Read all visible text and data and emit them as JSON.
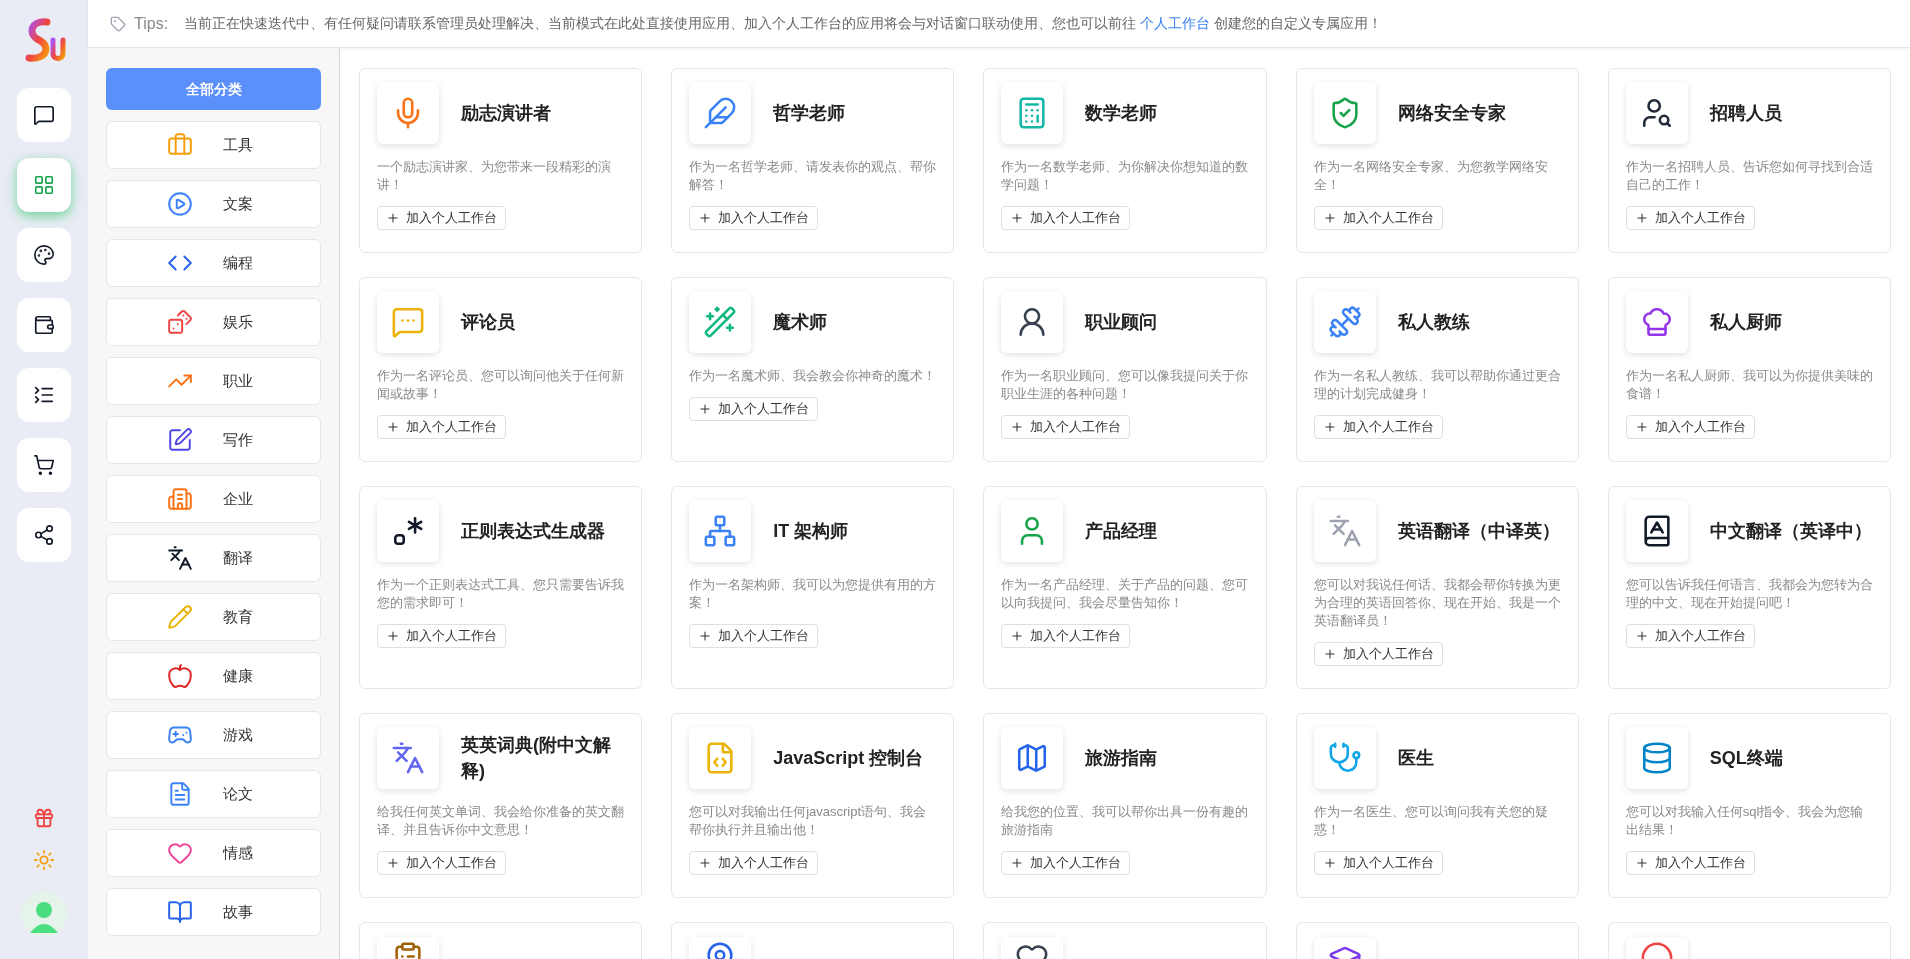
{
  "rail": {
    "items": [
      {
        "selected": false
      },
      {
        "selected": true
      },
      {
        "selected": false
      },
      {
        "selected": false
      },
      {
        "selected": false
      },
      {
        "selected": false
      },
      {
        "selected": false
      }
    ]
  },
  "tips": {
    "label": "Tips:",
    "text_before": "当前正在快速迭代中、有任何疑问请联系管理员处理解决、当前模式在此处直接使用应用、加入个人工作台的应用将会与对话窗口联动使用、您也可以前往 ",
    "link": "个人工作台",
    "text_after": " 创建您的自定义专属应用！"
  },
  "categories": [
    {
      "label": "全部分类",
      "selected": true
    },
    {
      "label": "工具",
      "selected": false
    },
    {
      "label": "文案",
      "selected": false
    },
    {
      "label": "编程",
      "selected": false
    },
    {
      "label": "娱乐",
      "selected": false
    },
    {
      "label": "职业",
      "selected": false
    },
    {
      "label": "写作",
      "selected": false
    },
    {
      "label": "企业",
      "selected": false
    },
    {
      "label": "翻译",
      "selected": false
    },
    {
      "label": "教育",
      "selected": false
    },
    {
      "label": "健康",
      "selected": false
    },
    {
      "label": "游戏",
      "selected": false
    },
    {
      "label": "论文",
      "selected": false
    },
    {
      "label": "情感",
      "selected": false
    },
    {
      "label": "故事",
      "selected": false
    }
  ],
  "apps": [
    {
      "title": "励志演讲者",
      "description": "一个励志演讲家、为您带来一段精彩的演讲！",
      "button": "加入个人工作台"
    },
    {
      "title": "哲学老师",
      "description": "作为一名哲学老师、请发表你的观点、帮你解答！",
      "button": "加入个人工作台"
    },
    {
      "title": "数学老师",
      "description": "作为一名数学老师、为你解决你想知道的数学问题！",
      "button": "加入个人工作台"
    },
    {
      "title": "网络安全专家",
      "description": "作为一名网络安全专家、为您教学网络安全！",
      "button": "加入个人工作台"
    },
    {
      "title": "招聘人员",
      "description": "作为一名招聘人员、告诉您如何寻找到合适自己的工作！",
      "button": "加入个人工作台"
    },
    {
      "title": "评论员",
      "description": "作为一名评论员、您可以询问他关于任何新闻或故事！",
      "button": "加入个人工作台"
    },
    {
      "title": "魔术师",
      "description": "作为一名魔术师、我会教会你神奇的魔术！",
      "button": "加入个人工作台"
    },
    {
      "title": "职业顾问",
      "description": "作为一名职业顾问、您可以像我提问关于你职业生涯的各种问题！",
      "button": "加入个人工作台"
    },
    {
      "title": "私人教练",
      "description": "作为一名私人教练、我可以帮助你通过更合理的计划完成健身！",
      "button": "加入个人工作台"
    },
    {
      "title": "私人厨师",
      "description": "作为一名私人厨师、我可以为你提供美味的食谱！",
      "button": "加入个人工作台"
    },
    {
      "title": "正则表达式生成器",
      "description": "作为一个正则表达式工具、您只需要告诉我您的需求即可！",
      "button": "加入个人工作台"
    },
    {
      "title": "IT 架构师",
      "description": "作为一名架构师、我可以为您提供有用的方案！",
      "button": "加入个人工作台"
    },
    {
      "title": "产品经理",
      "description": "作为一名产品经理、关于产品的问题、您可以向我提问、我会尽量告知你！",
      "button": "加入个人工作台"
    },
    {
      "title": "英语翻译（中译英）",
      "description": "您可以对我说任何话、我都会帮你转换为更为合理的英语回答你、现在开始、我是一个英语翻译员！",
      "button": "加入个人工作台"
    },
    {
      "title": "中文翻译（英译中）",
      "description": "您可以告诉我任何语言、我都会为您转为合理的中文、现在开始提问吧！",
      "button": "加入个人工作台"
    },
    {
      "title": "英英词典(附中文解释)",
      "description": "给我任何英文单词、我会给你准备的英文翻译、并且告诉你中文意思！",
      "button": "加入个人工作台"
    },
    {
      "title": "JavaScript 控制台",
      "description": "您可以对我输出任何javascript语句、我会帮你执行并且输出他！",
      "button": "加入个人工作台"
    },
    {
      "title": "旅游指南",
      "description": "给我您的位置、我可以帮你出具一份有趣的旅游指南",
      "button": "加入个人工作台"
    },
    {
      "title": "医生",
      "description": "作为一名医生、您可以询问我有关您的疑惑！",
      "button": "加入个人工作台"
    },
    {
      "title": "SQL终端",
      "description": "您可以对我输入任何sql指令、我会为您输出结果！",
      "button": "加入个人工作台"
    }
  ]
}
